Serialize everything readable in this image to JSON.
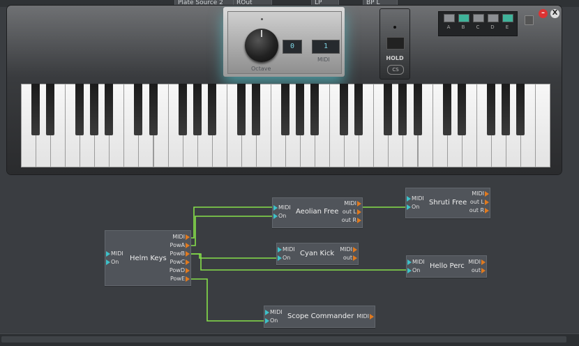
{
  "top_nodes": [
    {
      "label": "Plate Source 2"
    },
    {
      "label": "ROut"
    },
    {
      "label": "LP"
    },
    {
      "label": "BP L"
    }
  ],
  "keyboard": {
    "octave_label": "Octave",
    "octave_value": "0",
    "midi_label": "MIDI",
    "midi_value": "1",
    "hold_label": "HOLD",
    "logo_text": "CS",
    "presets": [
      "A",
      "B",
      "C",
      "D",
      "E"
    ],
    "preset_active": [
      false,
      true,
      false,
      false,
      true
    ],
    "close_glyph": "X",
    "min_glyph": "–"
  },
  "nodes": {
    "helm": {
      "title": "Helm Keys",
      "in_ports": [
        "MIDI",
        "On"
      ],
      "out_ports": [
        "MIDI",
        "PowA",
        "PowB",
        "PowC",
        "PowD",
        "PowE"
      ]
    },
    "aeolian": {
      "title": "Aeolian Free",
      "in_ports": [
        "MIDI",
        "On"
      ],
      "out_ports": [
        "MIDI",
        "out L",
        "out R"
      ]
    },
    "shruti": {
      "title": "Shruti Free",
      "in_ports": [
        "MIDI",
        "On"
      ],
      "out_ports": [
        "MIDI",
        "out L",
        "out R"
      ]
    },
    "cyan": {
      "title": "Cyan Kick",
      "in_ports": [
        "MIDI",
        "On"
      ],
      "out_ports": [
        "MIDI",
        "out"
      ]
    },
    "hello": {
      "title": "Hello Perc",
      "in_ports": [
        "MIDI",
        "On"
      ],
      "out_ports": [
        "MIDI",
        "out"
      ]
    },
    "scope": {
      "title": "Scope Commander",
      "in_ports": [
        "MIDI",
        "On"
      ],
      "out_ports": [
        "MIDI"
      ]
    }
  },
  "colors": {
    "wire": "#86e04a",
    "in_port": "#3ec1c9",
    "out_port": "#e07a1f",
    "preset_on": "#3fb39a"
  }
}
